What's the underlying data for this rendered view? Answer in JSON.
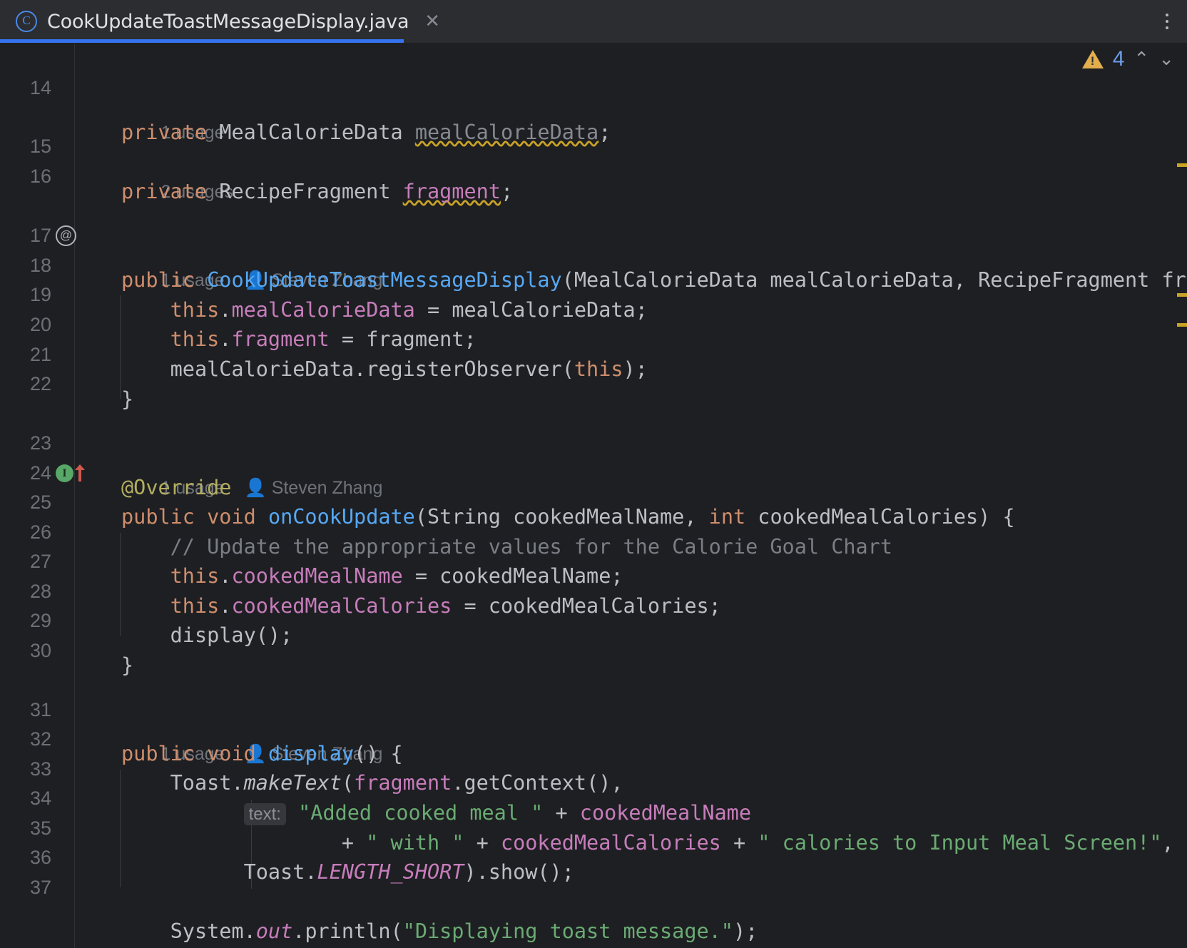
{
  "window": {
    "tab": {
      "title": "CookUpdateToastMessageDisplay.java",
      "icon": "java-class-icon",
      "icon_glyph": "C",
      "close_glyph": "✕"
    },
    "more_actions": "more-options-icon"
  },
  "inspection_widget": {
    "warning_count": "4",
    "warning_icon": "warning-triangle-icon",
    "prev_glyph": "⌃",
    "next_glyph": "⌄"
  },
  "colors": {
    "background": "#1e1f22",
    "tab_bar": "#2b2d30",
    "tab_active_underline": "#3574f0",
    "keyword": "#cf8e6d",
    "field": "#c77dbb",
    "class": "#56a8f5",
    "string": "#6aab73",
    "comment": "#7a7e85",
    "annotation": "#b3ae60",
    "plain": "#bcbec4",
    "line_number": "#6d7177",
    "warning": "#e3ae4d",
    "implement_marker": "#59a869",
    "override_arrow": "#d0584f"
  },
  "gutter": {
    "markers": [
      {
        "line": "17",
        "icon": "annotation-at-icon",
        "glyph": "@"
      },
      {
        "line": "24",
        "icon": "implementing-method-icon",
        "glyph": "I"
      },
      {
        "line": "24",
        "icon": "override-arrow-icon",
        "glyph": "↑"
      }
    ]
  },
  "editor": {
    "hints": [
      {
        "usages": "1 usage",
        "author": ""
      },
      {
        "usages": "2 usages",
        "author": ""
      },
      {
        "usages": "1 usage",
        "author": "Steven Zhang"
      },
      {
        "usages": "1 usage",
        "author": "Steven Zhang"
      },
      {
        "usages": "1 usage",
        "author": "Steven Zhang"
      }
    ],
    "parameter_hint": "text:",
    "lines": [
      {
        "n": "14",
        "text": "    private MealCalorieData mealCalorieData;"
      },
      {
        "n": "15",
        "text": "    private RecipeFragment fragment;"
      },
      {
        "n": "16",
        "text": ""
      },
      {
        "n": "17",
        "text": "    public CookUpdateToastMessageDisplay(MealCalorieData mealCalorieData, RecipeFragment fragment"
      },
      {
        "n": "18",
        "text": "        this.mealCalorieData = mealCalorieData;"
      },
      {
        "n": "19",
        "text": "        this.fragment = fragment;"
      },
      {
        "n": "20",
        "text": "        mealCalorieData.registerObserver(this);"
      },
      {
        "n": "21",
        "text": "    }"
      },
      {
        "n": "22",
        "text": ""
      },
      {
        "n": "23",
        "text": "    @Override"
      },
      {
        "n": "24",
        "text": "    public void onCookUpdate(String cookedMealName, int cookedMealCalories) {"
      },
      {
        "n": "25",
        "text": "        // Update the appropriate values for the Calorie Goal Chart"
      },
      {
        "n": "26",
        "text": "        this.cookedMealName = cookedMealName;"
      },
      {
        "n": "27",
        "text": "        this.cookedMealCalories = cookedMealCalories;"
      },
      {
        "n": "28",
        "text": "        display();"
      },
      {
        "n": "29",
        "text": "    }"
      },
      {
        "n": "30",
        "text": ""
      },
      {
        "n": "31",
        "text": "    public void display() {"
      },
      {
        "n": "32",
        "text": "        Toast.makeText(fragment.getContext(),"
      },
      {
        "n": "33",
        "text": "                text: \"Added cooked meal \" + cookedMealName"
      },
      {
        "n": "34",
        "text": "                        + \" with \" + cookedMealCalories + \" calories to Input Meal Screen!\","
      },
      {
        "n": "35",
        "text": "                Toast.LENGTH_SHORT).show();"
      },
      {
        "n": "36",
        "text": ""
      },
      {
        "n": "37",
        "text": "        System.out.println(\"Displaying toast message.\");"
      }
    ]
  }
}
